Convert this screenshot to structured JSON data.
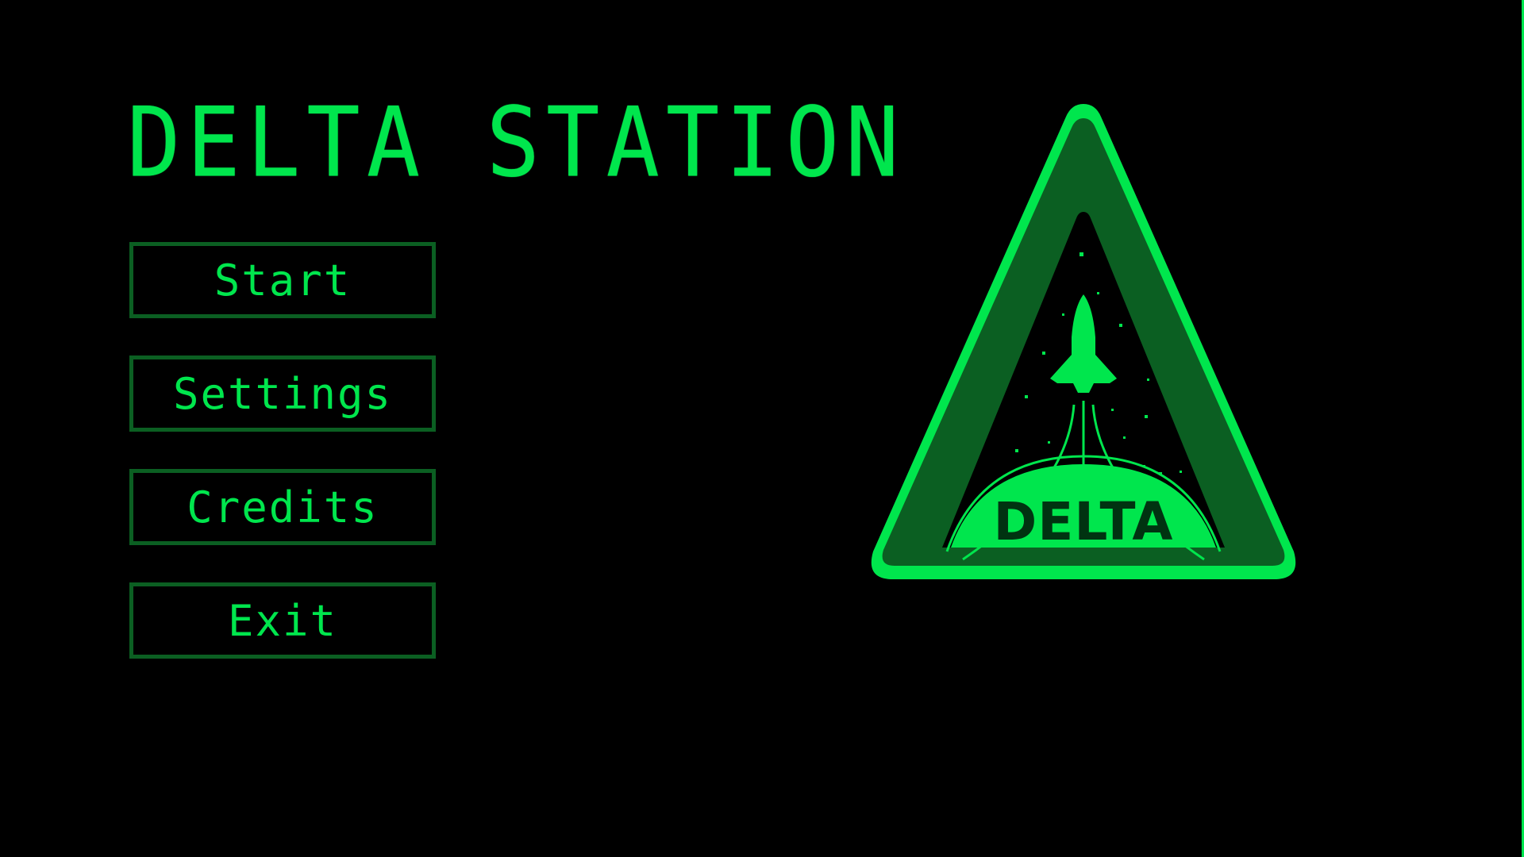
{
  "game": {
    "title": "DELTA STATION"
  },
  "menu": {
    "items": [
      {
        "label": "Start"
      },
      {
        "label": "Settings"
      },
      {
        "label": "Credits"
      },
      {
        "label": "Exit"
      }
    ]
  },
  "emblem": {
    "text": "DELTA",
    "icon": "rocket-launch-emblem"
  },
  "colors": {
    "background": "#000000",
    "primary_green": "#00e64d",
    "dark_green": "#0b5f22",
    "emblem_inner": "#003311"
  }
}
